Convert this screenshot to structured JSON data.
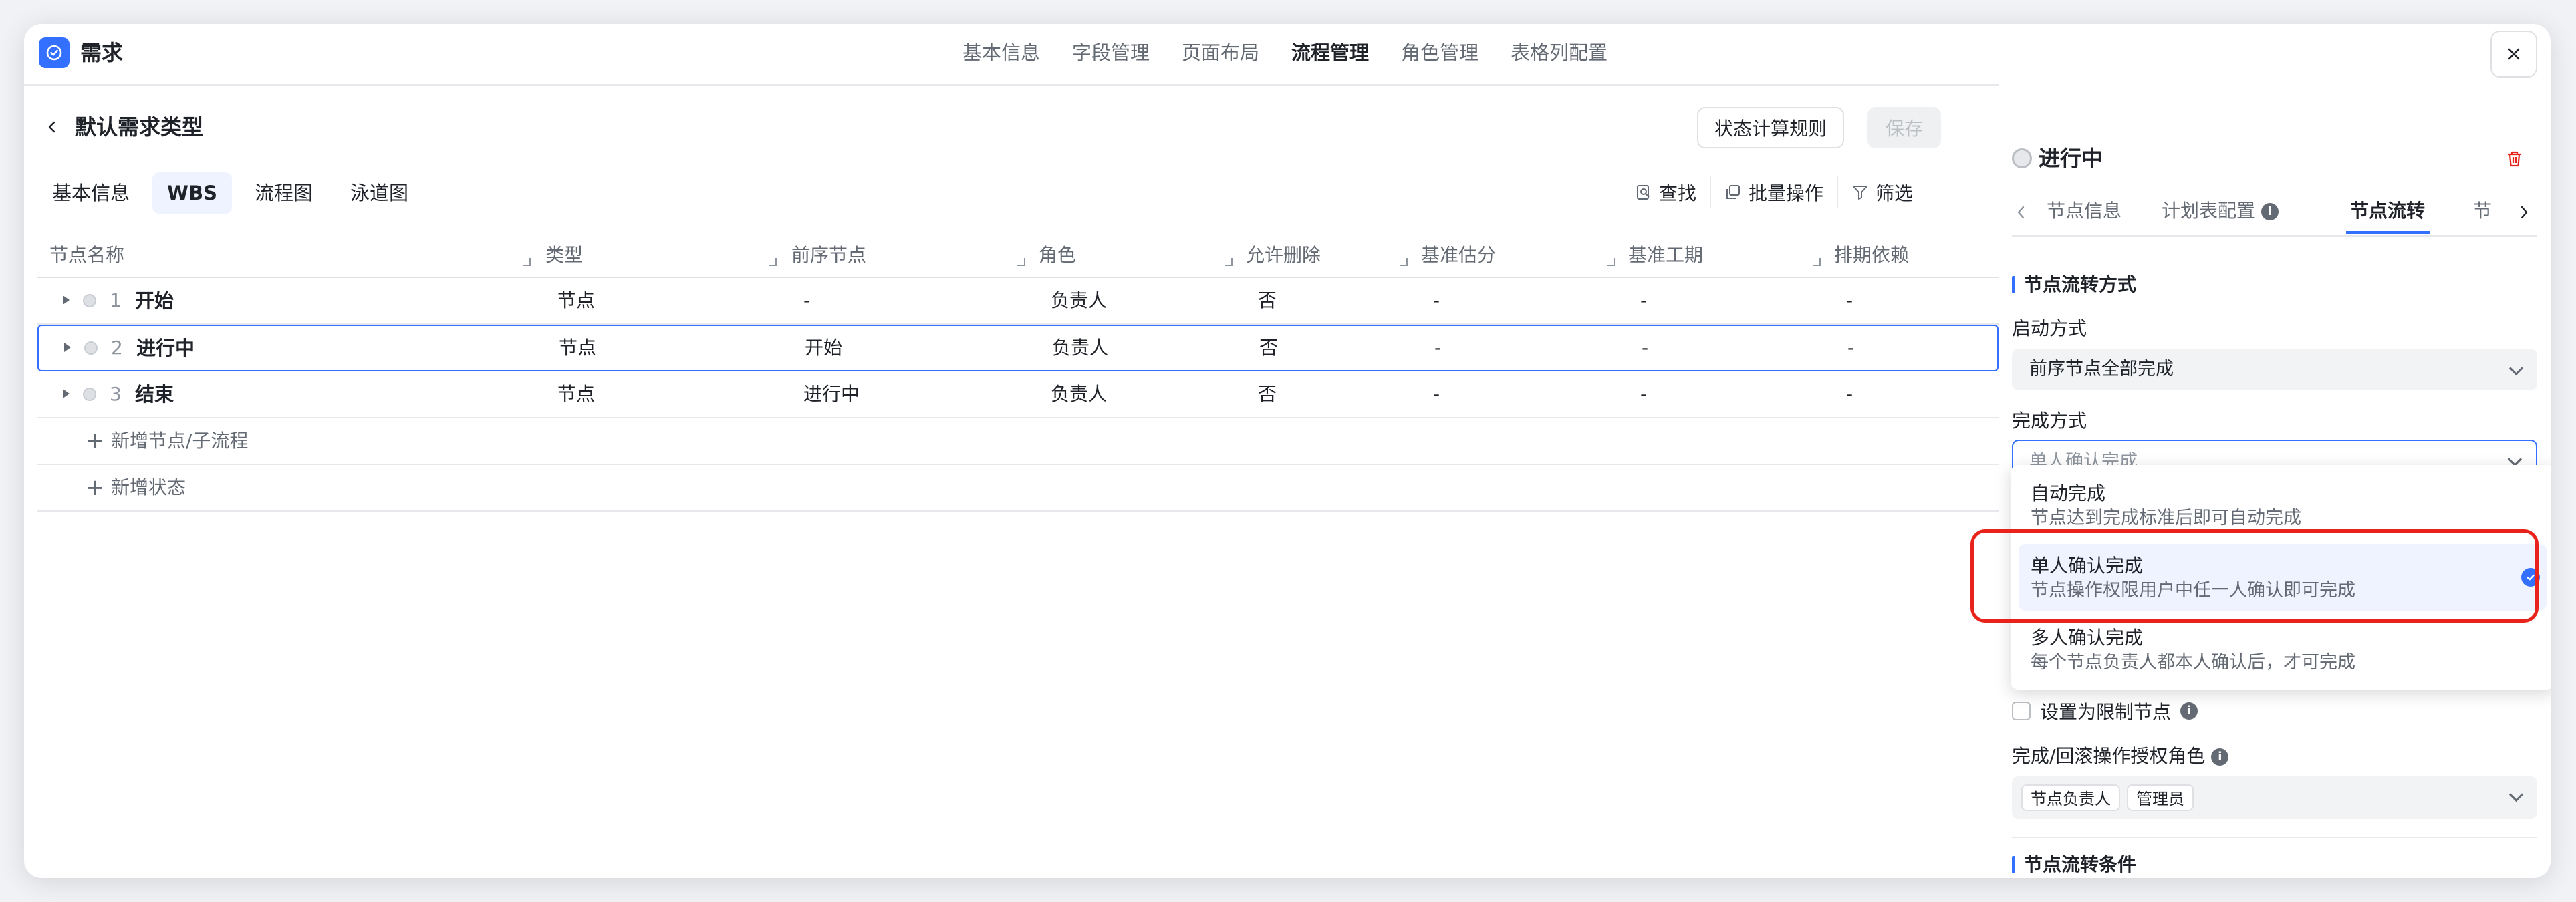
{
  "app": {
    "title": "需求"
  },
  "top_nav": [
    "基本信息",
    "字段管理",
    "页面布局",
    "流程管理",
    "角色管理",
    "表格列配置"
  ],
  "header": {
    "title": "默认需求类型",
    "rule_button": "状态计算规则",
    "save_button": "保存"
  },
  "sub_tabs": [
    "基本信息",
    "WBS",
    "流程图",
    "泳道图"
  ],
  "tools": {
    "find": "查找",
    "batch": "批量操作",
    "filter": "筛选"
  },
  "table": {
    "columns": [
      "节点名称",
      "类型",
      "前序节点",
      "角色",
      "允许删除",
      "基准估分",
      "基准工期",
      "排期依赖"
    ],
    "rows": [
      {
        "idx": "1",
        "name": "开始",
        "type": "节点",
        "prev": "-",
        "role": "负责人",
        "deletable": "否",
        "est": "-",
        "dur": "-",
        "dep": "-"
      },
      {
        "idx": "2",
        "name": "进行中",
        "type": "节点",
        "prev": "开始",
        "role": "负责人",
        "deletable": "否",
        "est": "-",
        "dur": "-",
        "dep": "-"
      },
      {
        "idx": "3",
        "name": "结束",
        "type": "节点",
        "prev": "进行中",
        "role": "负责人",
        "deletable": "否",
        "est": "-",
        "dur": "-",
        "dep": "-"
      }
    ],
    "add_node": "新增节点/子流程",
    "add_state": "新增状态"
  },
  "panel": {
    "title": "进行中",
    "tabs": [
      "节点信息",
      "计划表配置",
      "节点流转",
      "节"
    ],
    "section1": "节点流转方式",
    "start_label": "启动方式",
    "start_value": "前序节点全部完成",
    "complete_label": "完成方式",
    "complete_placeholder": "单人确认完成",
    "checkbox_label": "设置为限制节点",
    "auth_label": "完成/回滚操作授权角色",
    "auth_tags": [
      "节点负责人",
      "管理员"
    ],
    "section2": "节点流转条件"
  },
  "dropdown": {
    "options": [
      {
        "title": "自动完成",
        "desc": "节点达到完成标准后即可自动完成"
      },
      {
        "title": "单人确认完成",
        "desc": "节点操作权限用户中任一人确认即可完成"
      },
      {
        "title": "多人确认完成",
        "desc": "每个节点负责人都本人确认后，才可完成"
      }
    ],
    "selected_index": 1
  },
  "colors": {
    "accent": "#3370ff",
    "highlight": "#e8231c"
  }
}
